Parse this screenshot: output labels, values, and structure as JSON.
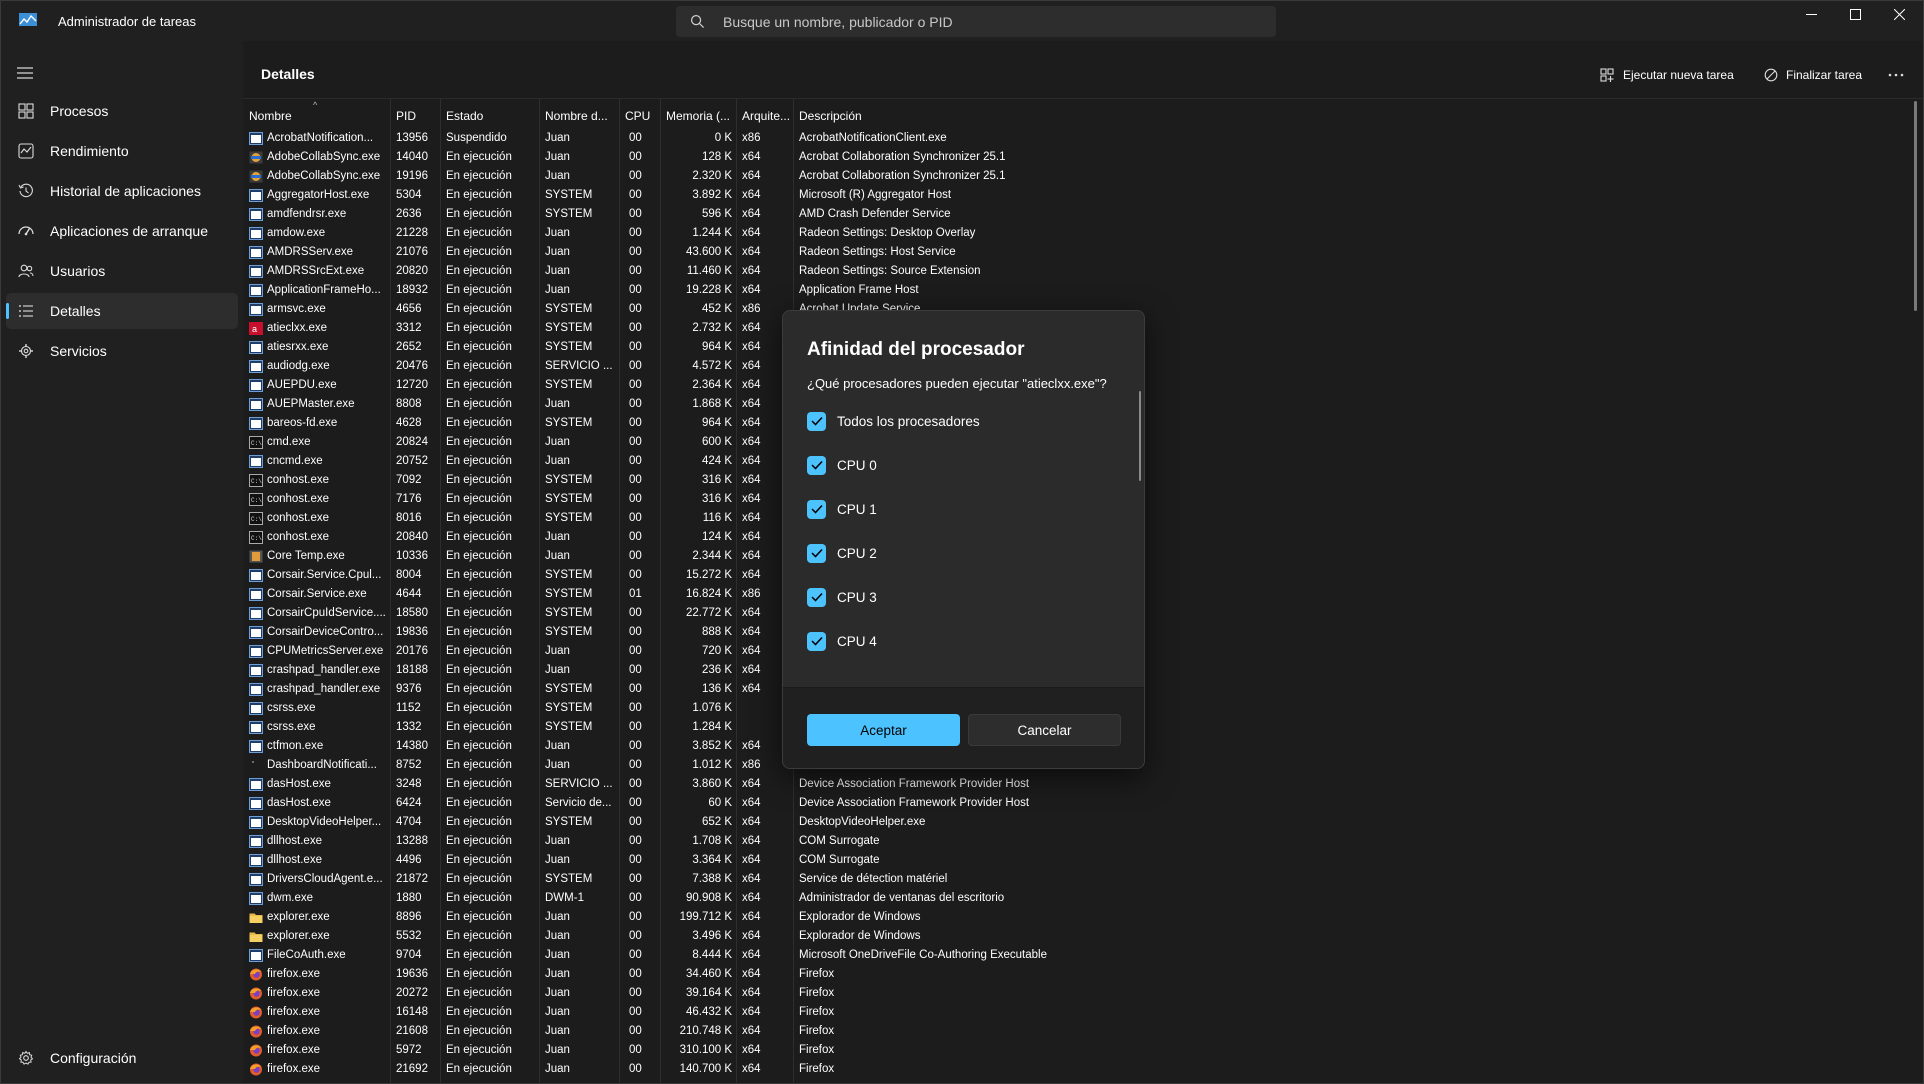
{
  "window": {
    "title": "Administrador de tareas",
    "search_placeholder": "Busque un nombre, publicador o PID"
  },
  "sidebar": {
    "items": [
      {
        "label": "Procesos",
        "icon": "processes-icon"
      },
      {
        "label": "Rendimiento",
        "icon": "performance-icon"
      },
      {
        "label": "Historial de aplicaciones",
        "icon": "history-icon"
      },
      {
        "label": "Aplicaciones de arranque",
        "icon": "startup-icon"
      },
      {
        "label": "Usuarios",
        "icon": "users-icon"
      },
      {
        "label": "Detalles",
        "icon": "details-icon",
        "active": true
      },
      {
        "label": "Servicios",
        "icon": "services-icon"
      }
    ],
    "settings_label": "Configuración"
  },
  "header": {
    "title": "Detalles",
    "run_task_label": "Ejecutar nueva tarea",
    "end_task_label": "Finalizar tarea"
  },
  "table": {
    "columns": [
      "Nombre",
      "PID",
      "Estado",
      "Nombre d...",
      "CPU",
      "Memoria (...",
      "Arquite...",
      "Descripción"
    ],
    "rows": [
      [
        "AcrobatNotification...",
        "13956",
        "Suspendido",
        "Juan",
        "00",
        "0 K",
        "x86",
        "AcrobatNotificationClient.exe"
      ],
      [
        "AdobeCollabSync.exe",
        "14040",
        "En ejecución",
        "Juan",
        "00",
        "128 K",
        "x64",
        "Acrobat Collaboration Synchronizer 25.1"
      ],
      [
        "AdobeCollabSync.exe",
        "19196",
        "En ejecución",
        "Juan",
        "00",
        "2.320 K",
        "x64",
        "Acrobat Collaboration Synchronizer 25.1"
      ],
      [
        "AggregatorHost.exe",
        "5304",
        "En ejecución",
        "SYSTEM",
        "00",
        "3.892 K",
        "x64",
        "Microsoft (R) Aggregator Host"
      ],
      [
        "amdfendrsr.exe",
        "2636",
        "En ejecución",
        "SYSTEM",
        "00",
        "596 K",
        "x64",
        "AMD Crash Defender Service"
      ],
      [
        "amdow.exe",
        "21228",
        "En ejecución",
        "Juan",
        "00",
        "1.244 K",
        "x64",
        "Radeon Settings: Desktop Overlay"
      ],
      [
        "AMDRSServ.exe",
        "21076",
        "En ejecución",
        "Juan",
        "00",
        "43.600 K",
        "x64",
        "Radeon Settings: Host Service"
      ],
      [
        "AMDRSSrcExt.exe",
        "20820",
        "En ejecución",
        "Juan",
        "00",
        "11.460 K",
        "x64",
        "Radeon Settings: Source Extension"
      ],
      [
        "ApplicationFrameHo...",
        "18932",
        "En ejecución",
        "Juan",
        "00",
        "19.228 K",
        "x64",
        "Application Frame Host"
      ],
      [
        "armsvc.exe",
        "4656",
        "En ejecución",
        "SYSTEM",
        "00",
        "452 K",
        "x86",
        "Acrobat Update Service"
      ],
      [
        "atieclxx.exe",
        "3312",
        "En ejecución",
        "SYSTEM",
        "00",
        "2.732 K",
        "x64",
        ""
      ],
      [
        "atiesrxx.exe",
        "2652",
        "En ejecución",
        "SYSTEM",
        "00",
        "964 K",
        "x64",
        ""
      ],
      [
        "audiodg.exe",
        "20476",
        "En ejecución",
        "SERVICIO ...",
        "00",
        "4.572 K",
        "x64",
        ""
      ],
      [
        "AUEPDU.exe",
        "12720",
        "En ejecución",
        "SYSTEM",
        "00",
        "2.364 K",
        "x64",
        ""
      ],
      [
        "AUEPMaster.exe",
        "8808",
        "En ejecución",
        "Juan",
        "00",
        "1.868 K",
        "x64",
        ""
      ],
      [
        "bareos-fd.exe",
        "4628",
        "En ejecución",
        "SYSTEM",
        "00",
        "964 K",
        "x64",
        ""
      ],
      [
        "cmd.exe",
        "20824",
        "En ejecución",
        "Juan",
        "00",
        "600 K",
        "x64",
        ""
      ],
      [
        "cncmd.exe",
        "20752",
        "En ejecución",
        "Juan",
        "00",
        "424 K",
        "x64",
        ""
      ],
      [
        "conhost.exe",
        "7092",
        "En ejecución",
        "SYSTEM",
        "00",
        "316 K",
        "x64",
        ""
      ],
      [
        "conhost.exe",
        "7176",
        "En ejecución",
        "SYSTEM",
        "00",
        "316 K",
        "x64",
        ""
      ],
      [
        "conhost.exe",
        "8016",
        "En ejecución",
        "SYSTEM",
        "00",
        "116 K",
        "x64",
        ""
      ],
      [
        "conhost.exe",
        "20840",
        "En ejecución",
        "Juan",
        "00",
        "124 K",
        "x64",
        ""
      ],
      [
        "Core Temp.exe",
        "10336",
        "En ejecución",
        "Juan",
        "00",
        "2.344 K",
        "x64",
        ""
      ],
      [
        "Corsair.Service.Cpul...",
        "8004",
        "En ejecución",
        "SYSTEM",
        "00",
        "15.272 K",
        "x64",
        ""
      ],
      [
        "Corsair.Service.exe",
        "4644",
        "En ejecución",
        "SYSTEM",
        "01",
        "16.824 K",
        "x86",
        ""
      ],
      [
        "CorsairCpuIdService....",
        "18580",
        "En ejecución",
        "SYSTEM",
        "00",
        "22.772 K",
        "x64",
        ""
      ],
      [
        "CorsairDeviceContro...",
        "19836",
        "En ejecución",
        "SYSTEM",
        "00",
        "888 K",
        "x64",
        ""
      ],
      [
        "CPUMetricsServer.exe",
        "20176",
        "En ejecución",
        "Juan",
        "00",
        "720 K",
        "x64",
        ""
      ],
      [
        "crashpad_handler.exe",
        "18188",
        "En ejecución",
        "Juan",
        "00",
        "236 K",
        "x64",
        ""
      ],
      [
        "crashpad_handler.exe",
        "9376",
        "En ejecución",
        "SYSTEM",
        "00",
        "136 K",
        "x64",
        ""
      ],
      [
        "csrss.exe",
        "1152",
        "En ejecución",
        "SYSTEM",
        "00",
        "1.076 K",
        "",
        ""
      ],
      [
        "csrss.exe",
        "1332",
        "En ejecución",
        "SYSTEM",
        "00",
        "1.284 K",
        "",
        ""
      ],
      [
        "ctfmon.exe",
        "14380",
        "En ejecución",
        "Juan",
        "00",
        "3.852 K",
        "x64",
        ""
      ],
      [
        "DashboardNotificati...",
        "8752",
        "En ejecución",
        "Juan",
        "00",
        "1.012 K",
        "x86",
        ""
      ],
      [
        "dasHost.exe",
        "3248",
        "En ejecución",
        "SERVICIO ...",
        "00",
        "3.860 K",
        "x64",
        "Device Association Framework Provider Host"
      ],
      [
        "dasHost.exe",
        "6424",
        "En ejecución",
        "Servicio de...",
        "00",
        "60 K",
        "x64",
        "Device Association Framework Provider Host"
      ],
      [
        "DesktopVideoHelper...",
        "4704",
        "En ejecución",
        "SYSTEM",
        "00",
        "652 K",
        "x64",
        "DesktopVideoHelper.exe"
      ],
      [
        "dllhost.exe",
        "13288",
        "En ejecución",
        "Juan",
        "00",
        "1.708 K",
        "x64",
        "COM Surrogate"
      ],
      [
        "dllhost.exe",
        "4496",
        "En ejecución",
        "Juan",
        "00",
        "3.364 K",
        "x64",
        "COM Surrogate"
      ],
      [
        "DriversCloudAgent.e...",
        "21872",
        "En ejecución",
        "SYSTEM",
        "00",
        "7.388 K",
        "x64",
        "Service de détection matériel"
      ],
      [
        "dwm.exe",
        "1880",
        "En ejecución",
        "DWM-1",
        "00",
        "90.908 K",
        "x64",
        "Administrador de ventanas del escritorio"
      ],
      [
        "explorer.exe",
        "8896",
        "En ejecución",
        "Juan",
        "00",
        "199.712 K",
        "x64",
        "Explorador de Windows"
      ],
      [
        "explorer.exe",
        "5532",
        "En ejecución",
        "Juan",
        "00",
        "3.496 K",
        "x64",
        "Explorador de Windows"
      ],
      [
        "FileCoAuth.exe",
        "9704",
        "En ejecución",
        "Juan",
        "00",
        "8.444 K",
        "x64",
        "Microsoft OneDriveFile Co-Authoring Executable"
      ],
      [
        "firefox.exe",
        "19636",
        "En ejecución",
        "Juan",
        "00",
        "34.460 K",
        "x64",
        "Firefox"
      ],
      [
        "firefox.exe",
        "20272",
        "En ejecución",
        "Juan",
        "00",
        "39.164 K",
        "x64",
        "Firefox"
      ],
      [
        "firefox.exe",
        "16148",
        "En ejecución",
        "Juan",
        "00",
        "46.432 K",
        "x64",
        "Firefox"
      ],
      [
        "firefox.exe",
        "21608",
        "En ejecución",
        "Juan",
        "00",
        "210.748 K",
        "x64",
        "Firefox"
      ],
      [
        "firefox.exe",
        "5972",
        "En ejecución",
        "Juan",
        "00",
        "310.100 K",
        "x64",
        "Firefox"
      ],
      [
        "firefox.exe",
        "21692",
        "En ejecución",
        "Juan",
        "00",
        "140.700 K",
        "x64",
        "Firefox"
      ]
    ],
    "row_icons": [
      "acrobat",
      "adobe",
      "adobe",
      "app",
      "app",
      "app",
      "app",
      "app",
      "app",
      "app",
      "ati",
      "app",
      "app",
      "app",
      "app",
      "app",
      "console",
      "app",
      "console",
      "console",
      "console",
      "console",
      "coretemp",
      "app",
      "app",
      "app",
      "app",
      "app",
      "app",
      "app",
      "app",
      "app",
      "app",
      "blank",
      "app",
      "app",
      "app",
      "app",
      "app",
      "app",
      "app",
      "folder",
      "folder",
      "app",
      "firefox",
      "firefox",
      "firefox",
      "firefox",
      "firefox",
      "firefox"
    ]
  },
  "dialog": {
    "title": "Afinidad del procesador",
    "question": "¿Qué procesadores pueden ejecutar \"atieclxx.exe\"?",
    "options": [
      {
        "label": "Todos los procesadores",
        "checked": true
      },
      {
        "label": "CPU 0",
        "checked": true
      },
      {
        "label": "CPU 1",
        "checked": true
      },
      {
        "label": "CPU 2",
        "checked": true
      },
      {
        "label": "CPU 3",
        "checked": true
      },
      {
        "label": "CPU 4",
        "checked": true
      }
    ],
    "accept_label": "Aceptar",
    "cancel_label": "Cancelar"
  },
  "colors": {
    "accent": "#4cc2ff",
    "background": "#1c1c1c",
    "sidebar": "#202020",
    "dialog": "#2b2b2b"
  }
}
